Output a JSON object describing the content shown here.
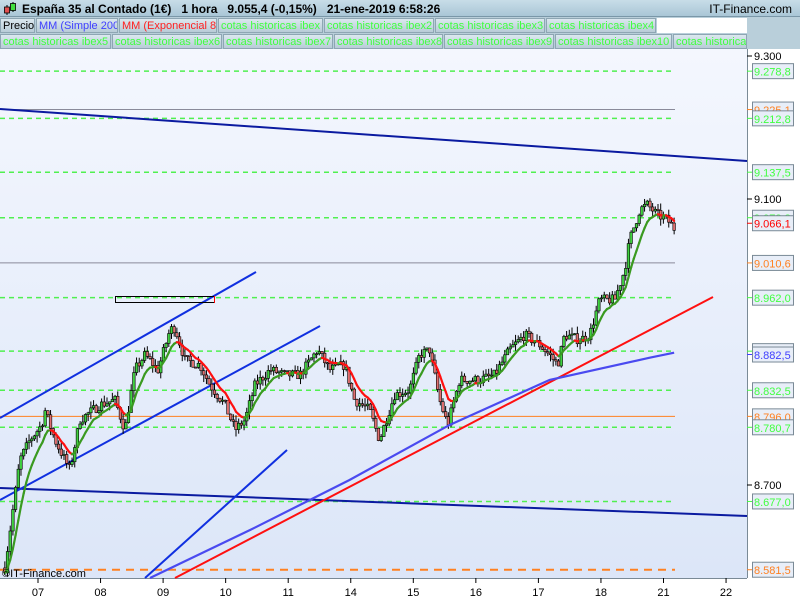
{
  "header": {
    "instrument": "España 35 al Contado (1€)",
    "timeframe": "1 hora",
    "last_price": "9.055,4 (-0,15%)",
    "datetime": "21-ene-2019 6:58:26",
    "brand": "IT-Finance.com"
  },
  "legend": {
    "row1": [
      {
        "label": "Precio",
        "color": "#000000"
      },
      {
        "label": "MM (Simple 200)",
        "color": "#4040ff"
      },
      {
        "label": "MM (Exponencial 8)",
        "color": "#ff2020"
      },
      {
        "label": "cotas historicas ibex",
        "color": "#40ff40"
      },
      {
        "label": "cotas historicas ibex2",
        "color": "#40ff40"
      },
      {
        "label": "cotas historicas ibex3",
        "color": "#40ff40"
      },
      {
        "label": "cotas historicas ibex4",
        "color": "#40ff40"
      }
    ],
    "row2": [
      {
        "label": "cotas historicas ibex5",
        "color": "#40ff40"
      },
      {
        "label": "cotas historicas ibex6",
        "color": "#40ff40"
      },
      {
        "label": "cotas historicas ibex7",
        "color": "#40ff40"
      },
      {
        "label": "cotas historicas ibex8",
        "color": "#40ff40"
      },
      {
        "label": "cotas historicas ibex9",
        "color": "#40ff40"
      },
      {
        "label": "cotas historicas ibex10",
        "color": "#40ff40"
      },
      {
        "label": "cotas historicas",
        "color": "#40ff40"
      }
    ]
  },
  "watermark": "©IT-Finance.com",
  "chart_data": {
    "type": "candlestick",
    "ylim": [
      8560,
      9340
    ],
    "y_ticks": [
      {
        "label": "9.300",
        "value": 9300
      },
      {
        "label": "9.100",
        "value": 9100
      },
      {
        "label": "8.700",
        "value": 8700
      }
    ],
    "x_ticks": [
      {
        "label": "07",
        "pos": 0
      },
      {
        "label": "08",
        "pos": 1
      },
      {
        "label": "09",
        "pos": 2
      },
      {
        "label": "10",
        "pos": 3
      },
      {
        "label": "11",
        "pos": 4
      },
      {
        "label": "14",
        "pos": 5
      },
      {
        "label": "15",
        "pos": 6
      },
      {
        "label": "16",
        "pos": 7
      },
      {
        "label": "17",
        "pos": 8
      },
      {
        "label": "18",
        "pos": 9
      },
      {
        "label": "21",
        "pos": 10
      },
      {
        "label": "22",
        "pos": 11
      }
    ],
    "price_path": [
      [
        -0.53,
        8584
      ],
      [
        -0.29,
        8735
      ],
      [
        -0.13,
        8763
      ],
      [
        0.06,
        8784
      ],
      [
        0.11,
        8805
      ],
      [
        0.27,
        8763
      ],
      [
        0.43,
        8735
      ],
      [
        0.51,
        8721
      ],
      [
        0.67,
        8791
      ],
      [
        0.99,
        8812
      ],
      [
        1.23,
        8819
      ],
      [
        1.39,
        8777
      ],
      [
        1.55,
        8861
      ],
      [
        1.71,
        8882
      ],
      [
        1.92,
        8861
      ],
      [
        2.11,
        8917
      ],
      [
        2.19,
        8920
      ],
      [
        2.35,
        8875
      ],
      [
        2.59,
        8868
      ],
      [
        2.75,
        8840
      ],
      [
        2.99,
        8812
      ],
      [
        3.15,
        8777
      ],
      [
        3.31,
        8791
      ],
      [
        3.47,
        8840
      ],
      [
        3.71,
        8861
      ],
      [
        3.95,
        8854
      ],
      [
        4.19,
        8854
      ],
      [
        4.47,
        8889
      ],
      [
        4.66,
        8861
      ],
      [
        4.9,
        8868
      ],
      [
        5.06,
        8819
      ],
      [
        5.3,
        8805
      ],
      [
        5.46,
        8763
      ],
      [
        5.7,
        8826
      ],
      [
        5.94,
        8833
      ],
      [
        6.1,
        8882
      ],
      [
        6.26,
        8889
      ],
      [
        6.42,
        8819
      ],
      [
        6.55,
        8784
      ],
      [
        6.74,
        8847
      ],
      [
        7.06,
        8847
      ],
      [
        7.3,
        8854
      ],
      [
        7.54,
        8889
      ],
      [
        7.78,
        8910
      ],
      [
        8.02,
        8896
      ],
      [
        8.18,
        8882
      ],
      [
        8.31,
        8868
      ],
      [
        8.42,
        8910
      ],
      [
        8.66,
        8903
      ],
      [
        8.82,
        8910
      ],
      [
        8.98,
        8959
      ],
      [
        9.22,
        8959
      ],
      [
        9.38,
        9001
      ],
      [
        9.46,
        9043
      ],
      [
        9.62,
        9085
      ],
      [
        9.74,
        9092
      ],
      [
        9.9,
        9078
      ],
      [
        10.06,
        9071
      ],
      [
        10.17,
        9059
      ]
    ],
    "sma200_path": [
      [
        1.79,
        8570
      ],
      [
        3.39,
        8637
      ],
      [
        4.98,
        8707
      ],
      [
        6.58,
        8784
      ],
      [
        8.18,
        8847
      ],
      [
        9.78,
        8878
      ],
      [
        10.17,
        8885
      ]
    ],
    "ema_period": 8,
    "levels": [
      {
        "value": 9278.8,
        "label": "9.278,8",
        "color": "#40ff40",
        "style": "dashed"
      },
      {
        "value": 9225.1,
        "label": "9.225,1",
        "color": "#ff8020",
        "style": "thin"
      },
      {
        "value": 9212.8,
        "label": "9.212,8",
        "color": "#40ff40",
        "style": "dashed"
      },
      {
        "value": 9137.5,
        "label": "9.137,5",
        "color": "#40ff40",
        "style": "dashed"
      },
      {
        "value": 9073.8,
        "label": "9.073,8",
        "color": "#40ff40",
        "style": "dashed"
      },
      {
        "value": 9066.1,
        "label": "9.066,1",
        "color": "#ff0000",
        "style": "none"
      },
      {
        "value": 9010.6,
        "label": "9.010,6",
        "color": "#ff8020",
        "style": "thin"
      },
      {
        "value": 8962.0,
        "label": "8.962,0",
        "color": "#40ff40",
        "style": "dashed"
      },
      {
        "value": 8887.2,
        "label": "8.887,2",
        "color": "#40ff40",
        "style": "dashed"
      },
      {
        "value": 8882.5,
        "label": "8.882,5",
        "color": "#4040ff",
        "style": "none"
      },
      {
        "value": 8832.5,
        "label": "8.832,5",
        "color": "#40ff40",
        "style": "dashed"
      },
      {
        "value": 8796.0,
        "label": "8.796,0",
        "color": "#ff8020",
        "style": "solid"
      },
      {
        "value": 8780.7,
        "label": "8.780,7",
        "color": "#40ff40",
        "style": "dashed"
      },
      {
        "value": 8677.0,
        "label": "8.677,0",
        "color": "#40ff40",
        "style": "dashed"
      },
      {
        "value": 8581.5,
        "label": "8.581,5",
        "color": "#ff8020",
        "style": "bigdash"
      }
    ]
  }
}
